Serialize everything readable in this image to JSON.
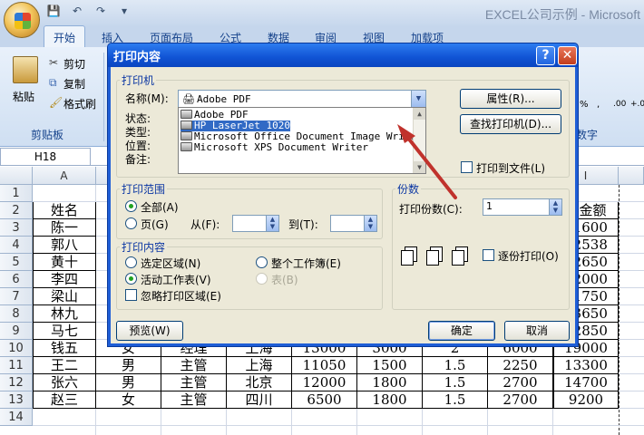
{
  "window": {
    "title": "EXCEL公司示例 - Microsoft"
  },
  "qat": {
    "save": "💾",
    "undo": "↶",
    "redo": "↷",
    "more": "▾"
  },
  "ribbon": {
    "tabs": [
      "开始",
      "插入",
      "页面布局",
      "公式",
      "数据",
      "审阅",
      "视图",
      "加载项"
    ],
    "paste_label": "粘贴",
    "cut_label": "剪切",
    "copy_label": "复制",
    "format_painter_label": "格式刷",
    "clipboard_group": "剪贴板",
    "number_group_tail": "数字",
    "number_format_buttons": [
      "%",
      ",",
      ".00",
      "+.0"
    ]
  },
  "formula": {
    "namebox": "H18"
  },
  "sheet": {
    "columns": [
      "A",
      "I"
    ],
    "row_numbers": [
      "1",
      "2",
      "3",
      "4",
      "5",
      "6",
      "7",
      "8",
      "9",
      "10",
      "11",
      "12",
      "13",
      "14"
    ],
    "col_a": [
      "",
      "姓名",
      "陈一",
      "郭八",
      "黄十",
      "李四",
      "梁山",
      "林九",
      "马七",
      "钱五",
      "王二",
      "张六",
      "赵三"
    ],
    "col_i": [
      "",
      "奖金额",
      "11600",
      "12538",
      "12650",
      "12000",
      "11750",
      "13650",
      "12850",
      "19000",
      "13300",
      "14700",
      "9200"
    ],
    "visible_rows": [
      [
        "钱五",
        "女",
        "经理",
        "上海",
        "13000",
        "3000",
        "2",
        "6000",
        "19000"
      ],
      [
        "王二",
        "男",
        "主管",
        "上海",
        "11050",
        "1500",
        "1.5",
        "2250",
        "13300"
      ],
      [
        "张六",
        "男",
        "主管",
        "北京",
        "12000",
        "1800",
        "1.5",
        "2700",
        "14700"
      ],
      [
        "赵三",
        "女",
        "主管",
        "四川",
        "6500",
        "1800",
        "1.5",
        "2700",
        "9200"
      ]
    ]
  },
  "dialog": {
    "title": "打印内容",
    "help": "?",
    "close": "✕",
    "printer_group": "打印机",
    "name_label": "名称(M):",
    "name_value": "Adobe PDF",
    "status_label": "状态:",
    "type_label": "类型:",
    "where_label": "位置:",
    "comment_label": "备注:",
    "printers": [
      "Adobe PDF",
      "HP LaserJet 1020",
      "Microsoft Office Document Image Writer",
      "Microsoft XPS Document Writer"
    ],
    "selected_printer_index": 1,
    "properties_button": "属性(R)...",
    "find_printer_button": "查找打印机(D)...",
    "print_to_file_label": "打印到文件(L)",
    "range_group": "打印范围",
    "all_label": "全部(A)",
    "pages_label": "页(G)",
    "from_label": "从(F):",
    "to_label": "到(T):",
    "content_group": "打印内容",
    "selection_label": "选定区域(N)",
    "workbook_label": "整个工作簿(E)",
    "active_sheet_label": "活动工作表(V)",
    "table_label": "表(B)",
    "ignore_area_label": "忽略打印区域(E)",
    "copies_group": "份数",
    "copies_label": "打印份数(C):",
    "copies_value": "1",
    "collate_label": "逐份打印(O)",
    "preview_button": "预览(W)",
    "ok_button": "确定",
    "cancel_button": "取消"
  }
}
